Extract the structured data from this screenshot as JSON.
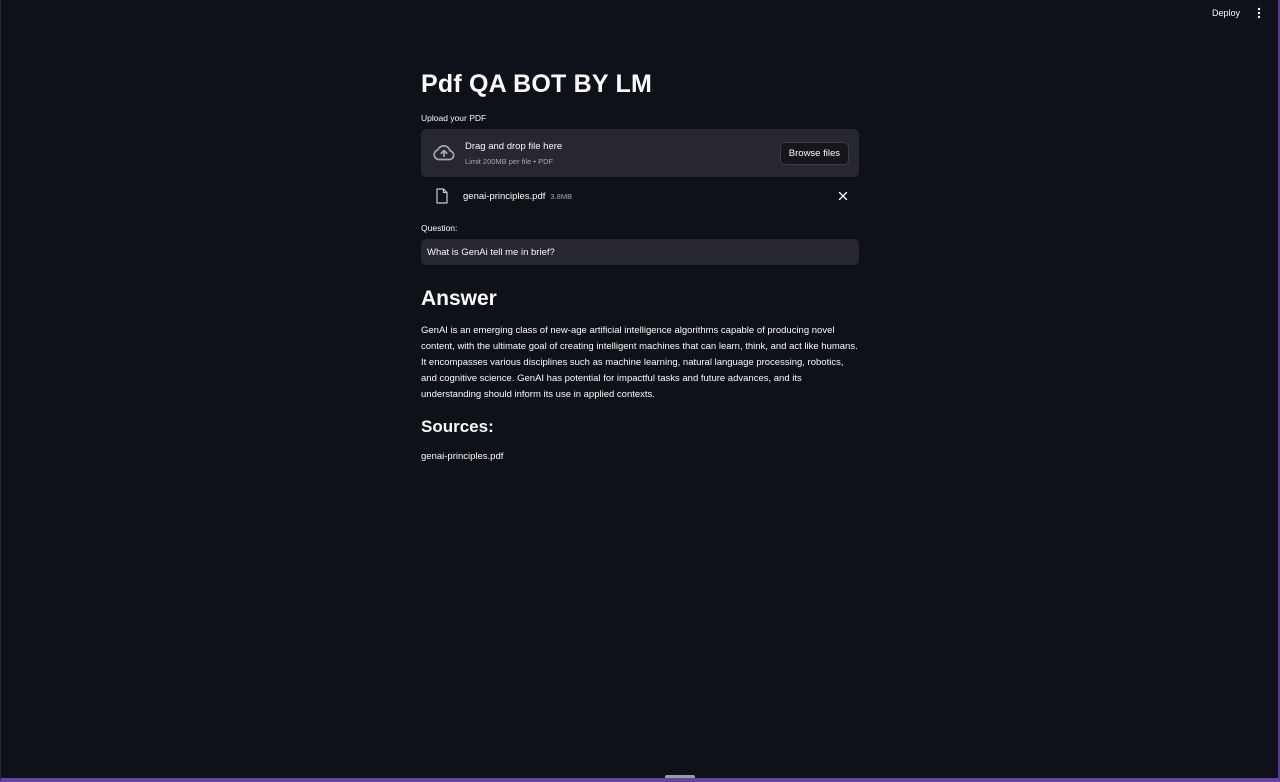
{
  "header": {
    "deploy_label": "Deploy",
    "menu_icon": "kebab-menu-icon"
  },
  "main": {
    "title": "Pdf QA BOT BY LM",
    "upload": {
      "label": "Upload your PDF",
      "drop_title": "Drag and drop file here",
      "drop_subtitle": "Limit 200MB per file • PDF",
      "browse_label": "Browse files",
      "icon": "cloud-upload-icon"
    },
    "uploaded_file": {
      "name": "genai-principles.pdf",
      "size": "3.8MB",
      "icon": "file-icon"
    },
    "question": {
      "label": "Question:",
      "value": "What is GenAi tell me in brief?"
    },
    "answer": {
      "heading": "Answer",
      "text": "GenAI is an emerging class of new-age artificial intelligence algorithms capable of producing novel content, with the ultimate goal of creating intelligent machines that can learn, think, and act like humans. It encompasses various disciplines such as machine learning, natural language processing, robotics, and cognitive science. GenAI has potential for impactful tasks and future advances, and its understanding should inform its use in applied contexts."
    },
    "sources": {
      "heading": "Sources:",
      "items": [
        "genai-principles.pdf"
      ]
    }
  },
  "colors": {
    "background": "#0e1117",
    "input_bg": "#262730",
    "text": "#fafafa",
    "muted": "#a3a8b4",
    "border_accent": "#6a3fa8"
  }
}
